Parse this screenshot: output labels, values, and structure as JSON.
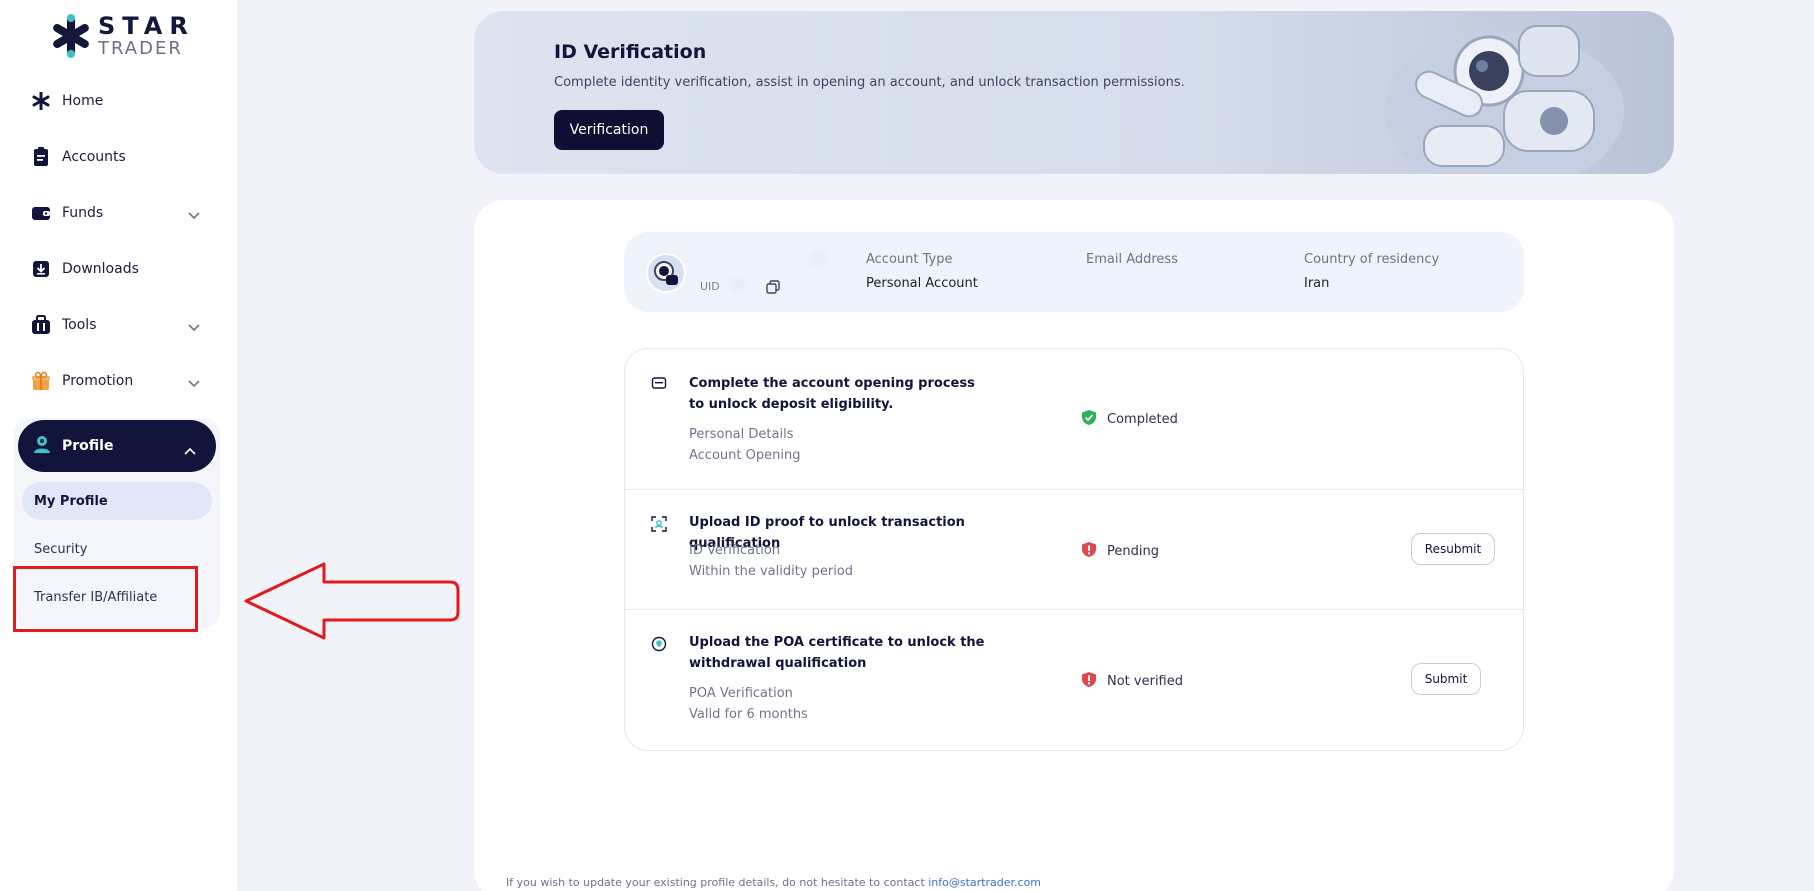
{
  "brand": {
    "line1": "STAR",
    "line2": "TRADER"
  },
  "sidebar": {
    "items": [
      {
        "label": "Home",
        "icon": "asterisk-icon"
      },
      {
        "label": "Accounts",
        "icon": "clipboard-icon"
      },
      {
        "label": "Funds",
        "icon": "wallet-icon"
      },
      {
        "label": "Downloads",
        "icon": "download-icon"
      },
      {
        "label": "Tools",
        "icon": "toolbox-icon"
      },
      {
        "label": "Promotion",
        "icon": "gift-icon"
      }
    ],
    "profile": {
      "label": "Profile",
      "sub_items": [
        {
          "label": "My Profile",
          "active": true
        },
        {
          "label": "Security",
          "active": false
        },
        {
          "label": "Transfer IB/Affiliate",
          "active": false
        }
      ]
    }
  },
  "banner": {
    "title": "ID Verification",
    "description": "Complete identity verification, assist in opening an account, and unlock transaction permissions.",
    "button": "Verification"
  },
  "user": {
    "uid_label": "UID",
    "account_type_label": "Account Type",
    "account_type_value": "Personal Account",
    "email_label": "Email Address",
    "email_value": "",
    "country_label": "Country of residency",
    "country_value": "Iran"
  },
  "steps": [
    {
      "title": "Complete the account opening process to unlock deposit eligibility.",
      "sub1": "Personal Details",
      "sub2": "Account Opening",
      "status": "Completed",
      "status_color": "#2fb15a",
      "button": ""
    },
    {
      "title": "Upload ID proof to unlock transaction qualification",
      "sub1": "ID Verification",
      "sub2": "Within the validity period",
      "status": "Pending",
      "status_color": "#e0474c",
      "button": "Resubmit"
    },
    {
      "title": "Upload the POA certificate to unlock the withdrawal qualification",
      "sub1": "POA Verification",
      "sub2": "Valid for 6 months",
      "status": "Not verified",
      "status_color": "#e0474c",
      "button": "Submit"
    }
  ],
  "footer": {
    "text": "If you wish to update your existing profile details, do not hesitate to contact ",
    "email": "info@startrader.com"
  },
  "colors": {
    "navy": "#12143b",
    "accent_teal": "#3cc3c8",
    "annotation_red": "#e01b1b"
  }
}
